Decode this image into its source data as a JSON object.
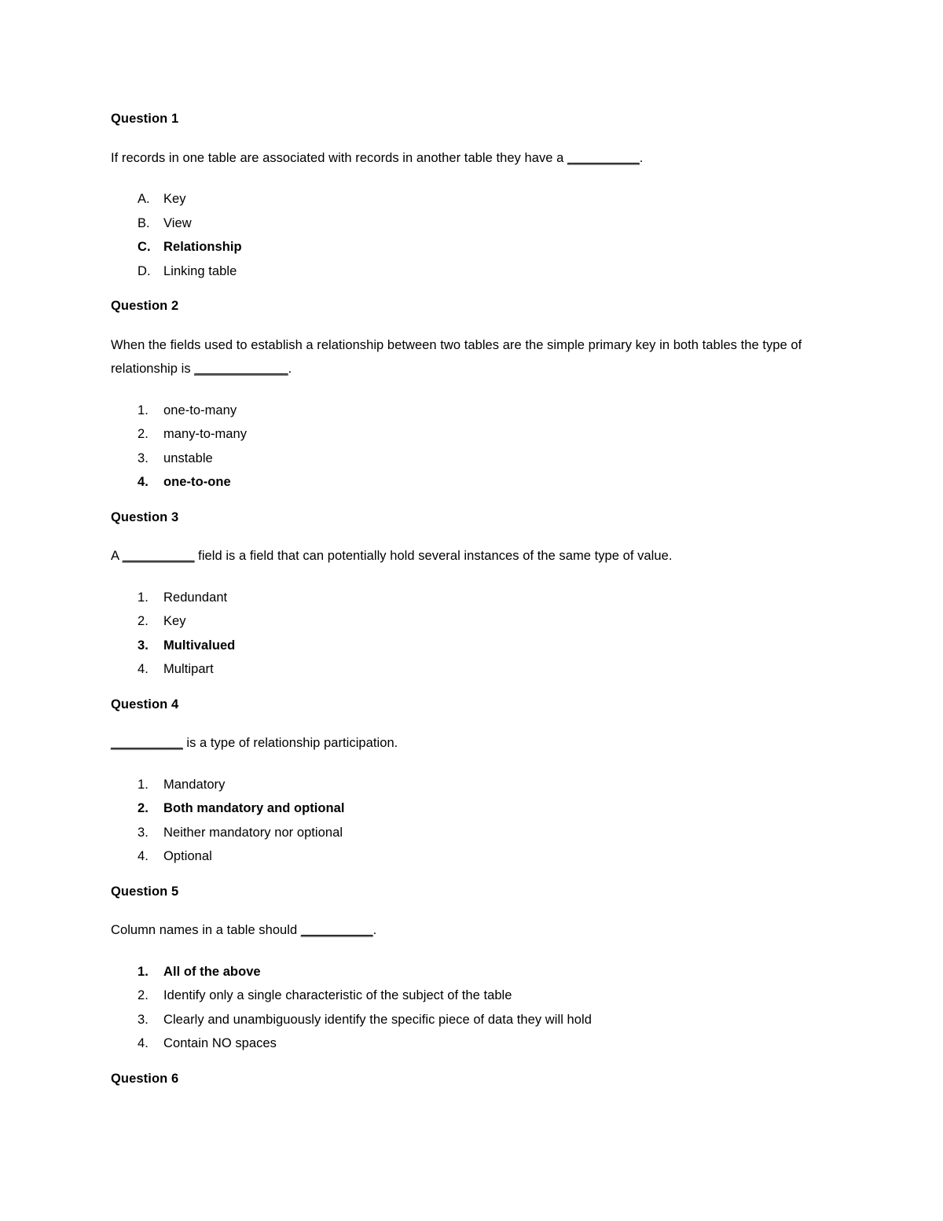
{
  "document": {
    "background_color": "#ffffff",
    "text_color": "#000000"
  },
  "questions": [
    {
      "heading": "Question 1",
      "stem_before": "If records in one table are associated with records in another table they have a ",
      "stem_blank": "__________",
      "stem_after": ".",
      "list_style": "upper-alpha",
      "options": [
        {
          "marker": "A.",
          "text": "Key",
          "correct": false
        },
        {
          "marker": "B.",
          "text": "View",
          "correct": false
        },
        {
          "marker": "C.",
          "text": "Relationship",
          "correct": true
        },
        {
          "marker": "D.",
          "text": "Linking table",
          "correct": false
        }
      ]
    },
    {
      "heading": "Question 2",
      "stem_before": "When the fields used to establish a relationship between two tables are the simple primary key in both tables the type of relationship is ",
      "stem_blank": "_____________",
      "stem_after": ".",
      "list_style": "decimal",
      "options": [
        {
          "marker": "1.",
          "text": "one-to-many",
          "correct": false
        },
        {
          "marker": "2.",
          "text": "many-to-many",
          "correct": false
        },
        {
          "marker": "3.",
          "text": "unstable",
          "correct": false
        },
        {
          "marker": "4.",
          "text": "one-to-one",
          "correct": true
        }
      ]
    },
    {
      "heading": "Question 3",
      "stem_before": "A ",
      "stem_blank": "__________",
      "stem_after": " field is a field that can potentially hold several instances of the same type of value.",
      "list_style": "decimal",
      "options": [
        {
          "marker": "1.",
          "text": "Redundant",
          "correct": false
        },
        {
          "marker": "2.",
          "text": "Key",
          "correct": false
        },
        {
          "marker": "3.",
          "text": "Multivalued",
          "correct": true
        },
        {
          "marker": "4.",
          "text": "Multipart",
          "correct": false
        }
      ]
    },
    {
      "heading": "Question 4",
      "stem_before": "",
      "stem_blank": "__________",
      "stem_after": " is a type of relationship participation.",
      "list_style": "decimal",
      "options": [
        {
          "marker": "1.",
          "text": "Mandatory",
          "correct": false
        },
        {
          "marker": "2.",
          "text": "Both mandatory and optional",
          "correct": true
        },
        {
          "marker": "3.",
          "text": "Neither mandatory nor optional",
          "correct": false
        },
        {
          "marker": "4.",
          "text": "Optional",
          "correct": false
        }
      ]
    },
    {
      "heading": "Question 5",
      "stem_before": "Column names in a table should ",
      "stem_blank": "__________",
      "stem_after": ".",
      "list_style": "decimal",
      "options": [
        {
          "marker": "1.",
          "text": "All of the above",
          "correct": true
        },
        {
          "marker": "2.",
          "text": "Identify only a single characteristic of the subject of the table",
          "correct": false
        },
        {
          "marker": "3.",
          "text": "Clearly and unambiguously identify the specific piece of data they will hold",
          "correct": false
        },
        {
          "marker": "4.",
          "text": "Contain NO spaces",
          "correct": false
        }
      ]
    },
    {
      "heading": "Question 6",
      "stem_before": "",
      "stem_blank": "",
      "stem_after": "",
      "list_style": "decimal",
      "options": []
    }
  ]
}
